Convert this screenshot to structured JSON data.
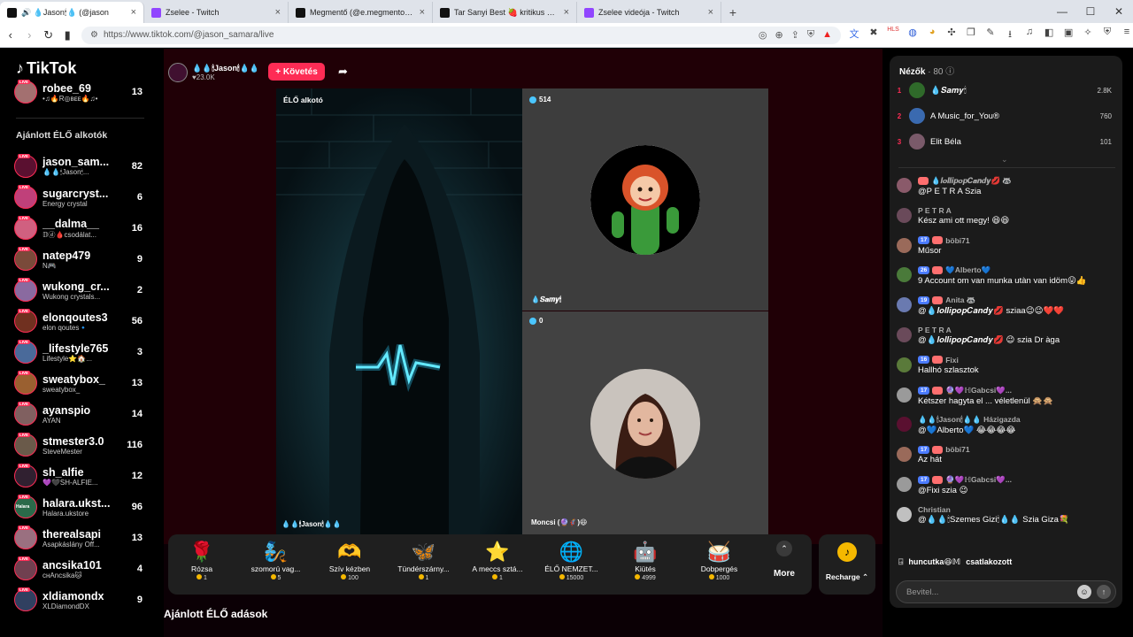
{
  "browser": {
    "tabs": [
      {
        "label": "🔊 💧Jason🕯💧 (@jason",
        "color": "#111111",
        "active": true
      },
      {
        "label": "Zselee - Twitch",
        "color": "#9146ff"
      },
      {
        "label": "Megmentő (@e.megmento) ÉLŐ adás",
        "color": "#111111"
      },
      {
        "label": "Tar Sanyi Best 🍓 kritikus 🐻 (@szop",
        "color": "#111111"
      },
      {
        "label": "Zselee videója - Twitch",
        "color": "#9146ff"
      }
    ],
    "url": "https://www.tiktok.com/@jason_samara/live",
    "win_min": "—",
    "win_max": "☐",
    "win_close": "✕"
  },
  "sidebar": {
    "logo": "TikTok",
    "current_user": {
      "name": "robee_69",
      "sub": "•♫🔥R◎ʙᴇᴇ🔥♫•",
      "count": "13",
      "color": "#a37070"
    },
    "section_title": "Ajánlott ÉLŐ alkotók",
    "live_badge": "LIVE",
    "creators": [
      {
        "name": "jason_sam...",
        "sub": "💧💧🕯Jason🕯...",
        "count": "82",
        "color": "#5a1030"
      },
      {
        "name": "sugarcryst...",
        "sub": "Energy crystal",
        "count": "6",
        "color": "#c0407a"
      },
      {
        "name": "__dalma__",
        "sub": "𝔻ⓓ🩸csodálat...",
        "count": "16",
        "color": "#d06080"
      },
      {
        "name": "natep479",
        "sub": "N🎮",
        "count": "9",
        "color": "#7a4a3a"
      },
      {
        "name": "wukong_cr...",
        "sub": "Wukong crystals...",
        "count": "2",
        "color": "#8a6aa0"
      },
      {
        "name": "elonqoutes3",
        "sub": "elon qoutes🔹",
        "count": "56",
        "color": "#703020"
      },
      {
        "name": "_lifestyle765",
        "sub": "Lifestyle⭐🏠...",
        "count": "3",
        "color": "#4a6a9a"
      },
      {
        "name": "sweatybox_",
        "sub": "sweatybox_",
        "count": "13",
        "color": "#9a6030"
      },
      {
        "name": "ayanspio",
        "sub": "AYAN",
        "count": "14",
        "color": "#806060"
      },
      {
        "name": "stmester3.0",
        "sub": "SteveMester",
        "count": "116",
        "color": "#6a5a4a"
      },
      {
        "name": "sh_alfie",
        "sub": "💜🖤SH-ALFIE...",
        "count": "12",
        "color": "#302030"
      },
      {
        "name": "halara.ukst...",
        "sub": "Halara.ukstore",
        "count": "96",
        "color": "#2a6a4a",
        "avatar_text": "Halara"
      },
      {
        "name": "therealsapi",
        "sub": "Asapkáslány Off...",
        "count": "13",
        "color": "#9a7080"
      },
      {
        "name": "ancsika101",
        "sub": "ᴄʜAncsika🐱",
        "count": "4",
        "color": "#704050"
      },
      {
        "name": "xldiamondx",
        "sub": "XLDiamondDX",
        "count": "9",
        "color": "#304060"
      }
    ]
  },
  "stream": {
    "host_name": "💧💧🕯Jason🕯💧💧",
    "host_likes": "♥23.0K",
    "follow_label": "+ Követés",
    "share_icon": "➦",
    "main_label": "ÉLŐ alkotó",
    "main_caption": "💧💧🕯Jason🕯💧💧",
    "guest1": {
      "viewers": "514",
      "caption": "💧𝑺𝒂𝒎𝒚🕯"
    },
    "guest2": {
      "viewers": "0",
      "caption": "Moncsi (🔮🦸)😆"
    }
  },
  "gifts": [
    {
      "name": "Rózsa",
      "price": "1",
      "icon": "🌹"
    },
    {
      "name": "szomorú vag...",
      "price": "5",
      "icon": "🧞"
    },
    {
      "name": "Szív kézben",
      "price": "100",
      "icon": "🫶"
    },
    {
      "name": "Tündérszárny...",
      "price": "1",
      "icon": "🦋"
    },
    {
      "name": "A meccs sztá...",
      "price": "1",
      "icon": "⭐"
    },
    {
      "name": "ÉLŐ NEMZET...",
      "price": "15000",
      "icon": "🌐"
    },
    {
      "name": "Kiütés",
      "price": "4999",
      "icon": "🤖"
    },
    {
      "name": "Dobpergés",
      "price": "1000",
      "icon": "🥁"
    }
  ],
  "more_label": "More",
  "more_icon": "⌃",
  "recharge_label": "Recharge ⌃",
  "recharge_icon": "♪",
  "recommended_title": "Ajánlott ÉLŐ adások",
  "chat": {
    "viewers_label": "Nézők",
    "viewers_count": "· 80",
    "info_icon": "ⓘ",
    "ranking": [
      {
        "rank": "1",
        "name": "💧𝑺𝒂𝒎𝒚🕯",
        "score": "2.8K",
        "color": "#2f6a2a"
      },
      {
        "rank": "2",
        "name": "A Music_for_You®",
        "score": "760",
        "color": "#3a6ab0"
      },
      {
        "rank": "3",
        "name": "Elit Béla",
        "score": "101",
        "color": "#7a5a6a"
      }
    ],
    "collapse_icon": "⌄",
    "messages": [
      {
        "head": "💧𝒍𝒐𝒍𝒍𝒊𝒑𝒐𝒑𝑪𝒂𝒏𝒅𝒚💋 🦝",
        "text": "@P E T R A Szia",
        "color": "#8a5a6a",
        "lvl": "",
        "fan": true
      },
      {
        "head": "P E T R A",
        "text": "Kész ami ott megy! 😆😆",
        "color": "#6a4a5a",
        "lvl": "",
        "fan": false
      },
      {
        "head": "böbi71",
        "text": "Műsor",
        "color": "#9a6a5a",
        "lvl": "17",
        "fan": true
      },
      {
        "head": "💙Alberto💙",
        "text": "9 Account om van munka utàn van idöm😛👍",
        "color": "#4a7a3a",
        "lvl": "26",
        "fan": true
      },
      {
        "head": "Anita 🦝",
        "text": "@💧𝒍𝒐𝒍𝒍𝒊𝒑𝒐𝒑𝑪𝒂𝒏𝒅𝒚💋 sziaa😉😉❤️❤️",
        "color": "#6a7ab0",
        "lvl": "19",
        "fan": true
      },
      {
        "head": "P E T R A",
        "text": "@💧𝒍𝒐𝒍𝒍𝒊𝒑𝒐𝒑𝑪𝒂𝒏𝒅𝒚💋 😉 szia Dr àga",
        "color": "#6a4a5a",
        "lvl": "",
        "fan": false
      },
      {
        "head": "Fixi",
        "text": "Hallhó szlasztok",
        "color": "#5a7a3a",
        "lvl": "16",
        "fan": true
      },
      {
        "head": "🔮💜ℍGabcsi💜...",
        "text": "Kétszer hagyta el ... véletlenül 🙊🙊",
        "color": "#9a9a9a",
        "lvl": "17",
        "fan": true
      },
      {
        "head": "💧💧🕯Jason🕯💧💧 Házigazda",
        "text": "@💙Alberto💙 😂😂😂😂",
        "color": "#5a1030",
        "lvl": "",
        "fan": false
      },
      {
        "head": "böbi71",
        "text": "Az hát",
        "color": "#9a6a5a",
        "lvl": "17",
        "fan": true
      },
      {
        "head": "🔮💜ℍGabcsi💜...",
        "text": "@Fixi szia 😉",
        "color": "#9a9a9a",
        "lvl": "17",
        "fan": true
      },
      {
        "head": "Christian",
        "text": "@💧💧🕯Szemes Gizi🕯💧💧 Szia Giza💐",
        "color": "#c0c0c0",
        "lvl": "",
        "fan": false
      }
    ],
    "joined": {
      "icon": "⍈",
      "name": "huncutka😆𝕄",
      "text": "csatlakozott"
    },
    "input_placeholder": "Bevitel...",
    "emoji_icon": "☺",
    "send_icon": "↑"
  }
}
